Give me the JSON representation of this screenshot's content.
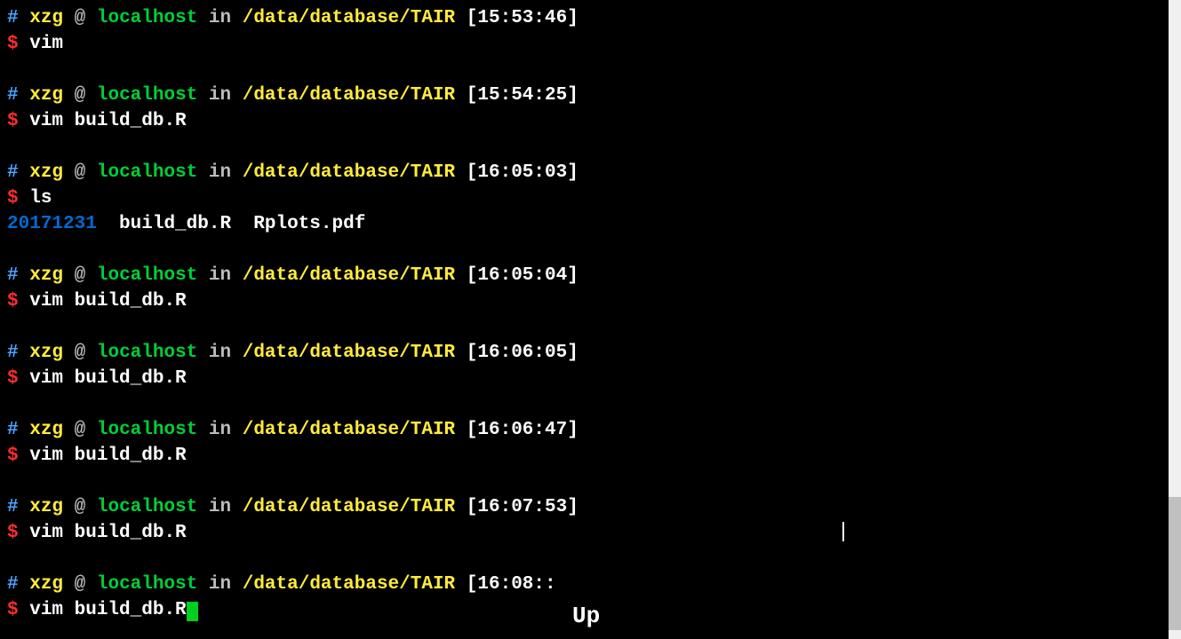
{
  "prompt": {
    "hash": "#",
    "user": "xzg",
    "at": "@",
    "host": "localhost",
    "in": "in",
    "path": "/data/database/TAIR",
    "dollar": "$"
  },
  "blocks": [
    {
      "time": "[15:53:46]",
      "cmd": "vim"
    },
    {
      "time": "[15:54:25]",
      "cmd": "vim build_db.R"
    },
    {
      "time": "[16:05:03]",
      "cmd": "ls",
      "output": {
        "dir": "20171231",
        "files": "build_db.R  Rplots.pdf"
      }
    },
    {
      "time": "[16:05:04]",
      "cmd": "vim build_db.R"
    },
    {
      "time": "[16:06:05]",
      "cmd": "vim build_db.R"
    },
    {
      "time": "[16:06:47]",
      "cmd": "vim build_db.R"
    },
    {
      "time": "[16:07:53]",
      "cmd": "vim build_db.R"
    }
  ],
  "current": {
    "time": "[16:08::",
    "cmd": "vim build_db.R"
  },
  "key_indicator": "Up"
}
